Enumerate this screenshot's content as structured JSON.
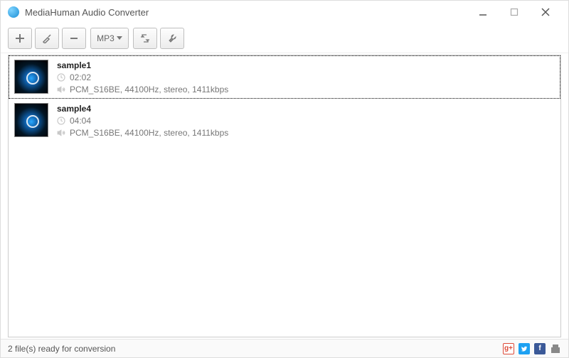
{
  "window": {
    "title": "MediaHuman Audio Converter"
  },
  "toolbar": {
    "format_label": "MP3"
  },
  "items": [
    {
      "name": "sample1",
      "duration": "02:02",
      "details": "PCM_S16BE, 44100Hz, stereo, 1411kbps",
      "selected": true
    },
    {
      "name": "sample4",
      "duration": "04:04",
      "details": "PCM_S16BE, 44100Hz, stereo, 1411kbps",
      "selected": false
    }
  ],
  "status": {
    "text": "2 file(s) ready for conversion"
  }
}
